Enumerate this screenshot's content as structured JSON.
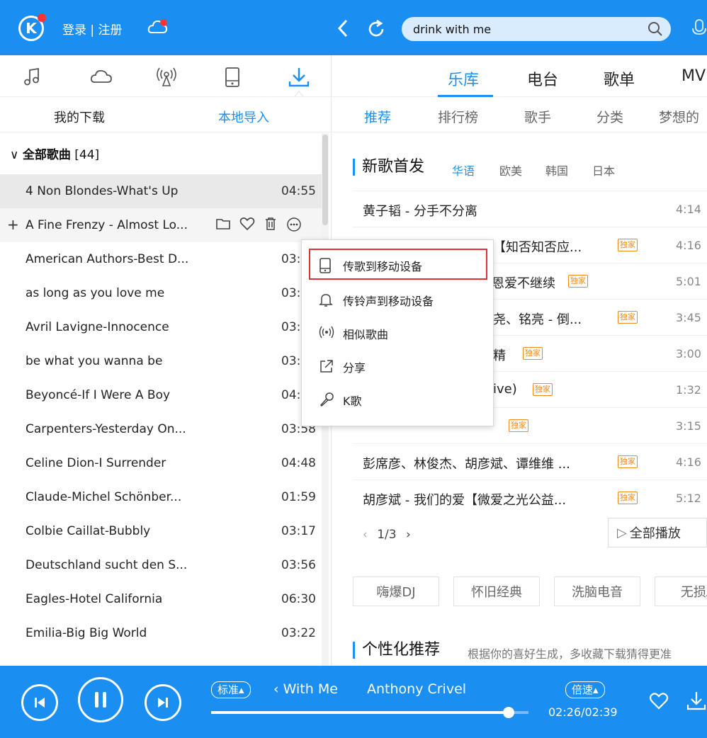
{
  "colors": {
    "brand": "#1b8ff1",
    "highlight_box": "#e23030",
    "badge": "#f28a1c"
  },
  "header": {
    "logo": "K",
    "login_label": "登录 | 注册",
    "search": {
      "value": "drink with me"
    }
  },
  "left": {
    "icon_tabs": [
      "music-note-icon",
      "cloud-icon",
      "radio-icon",
      "device-icon",
      "download-icon"
    ],
    "sub_tabs": {
      "my_downloads": "我的下载",
      "local_import": "本地导入"
    },
    "group": {
      "name": "全部歌曲",
      "count": "[44]"
    },
    "songs": [
      {
        "title": "4 Non Blondes-What's Up",
        "duration": "04:55"
      },
      {
        "title": "A Fine Frenzy - Almost Lo...",
        "duration": ""
      },
      {
        "title": "American Authors-Best D...",
        "duration": "03:"
      },
      {
        "title": "as long as you love me",
        "duration": "03:"
      },
      {
        "title": "Avril Lavigne-Innocence",
        "duration": "03:"
      },
      {
        "title": "be what you wanna be",
        "duration": "03:"
      },
      {
        "title": "Beyoncé-If I Were A Boy",
        "duration": "04:"
      },
      {
        "title": "Carpenters-Yesterday On...",
        "duration": "03:58"
      },
      {
        "title": "Celine Dion-I Surrender",
        "duration": "04:48"
      },
      {
        "title": "Claude-Michel Schönber...",
        "duration": "01:59"
      },
      {
        "title": "Colbie Caillat-Bubbly",
        "duration": "03:17"
      },
      {
        "title": "Deutschland sucht den S...",
        "duration": "03:56"
      },
      {
        "title": "Eagles-Hotel California",
        "duration": "06:30"
      },
      {
        "title": "Emilia-Big Big World",
        "duration": "03:22"
      }
    ]
  },
  "context_menu": {
    "items": [
      {
        "label": "传歌到移动设备",
        "icon": "device-icon"
      },
      {
        "label": "传铃声到移动设备",
        "icon": "bell-icon"
      },
      {
        "label": "相似歌曲",
        "icon": "radio-wave-icon"
      },
      {
        "label": "分享",
        "icon": "share-icon"
      },
      {
        "label": "K歌",
        "icon": "microphone-icon"
      }
    ]
  },
  "right": {
    "main_tabs": [
      "乐库",
      "电台",
      "歌单",
      "MV"
    ],
    "categories": [
      "推荐",
      "排行榜",
      "歌手",
      "分类",
      "梦想的"
    ],
    "new_songs": {
      "title": "新歌首发",
      "tags": [
        "华语",
        "欧美",
        "韩国",
        "日本"
      ],
      "items": [
        {
          "name": "黄子韬 - 分手不分离",
          "duration": "4:14",
          "badge": ""
        },
        {
          "name": "【知否知否应...",
          "duration": "4:16",
          "badge": "独家"
        },
        {
          "name": "恩爱不继续",
          "duration": "5:01",
          "badge": "独家"
        },
        {
          "name": "尧、铭亮 - 倒...",
          "duration": "3:45",
          "badge": "独家"
        },
        {
          "name": "精",
          "duration": "3:00",
          "badge": "独家"
        },
        {
          "name": "ive)",
          "duration": "1:32",
          "badge": "独家"
        },
        {
          "name": "",
          "duration": "3:15",
          "badge": "独家"
        },
        {
          "name": "彭席彦、林俊杰、胡彦斌、谭维维 ...",
          "duration": "4:16",
          "badge": "独家"
        },
        {
          "name": "胡彦斌 - 我们的爱【微爱之光公益...",
          "duration": "5:12",
          "badge": "独家"
        }
      ],
      "pager": "1/3",
      "play_all": "全部播放"
    },
    "genres": [
      "嗨爆DJ",
      "怀旧经典",
      "洗脑电音",
      "无损A"
    ],
    "personal": {
      "title": "个性化推荐",
      "subtitle": "根据你的喜好生成，多收藏下载猜得更准"
    }
  },
  "player": {
    "quality": "标准▴",
    "track_title": "‹ With Me",
    "artist": "Anthony Crivel",
    "speed": "倍速▴",
    "time": "02:26/02:39",
    "progress_fraction": 0.937
  }
}
